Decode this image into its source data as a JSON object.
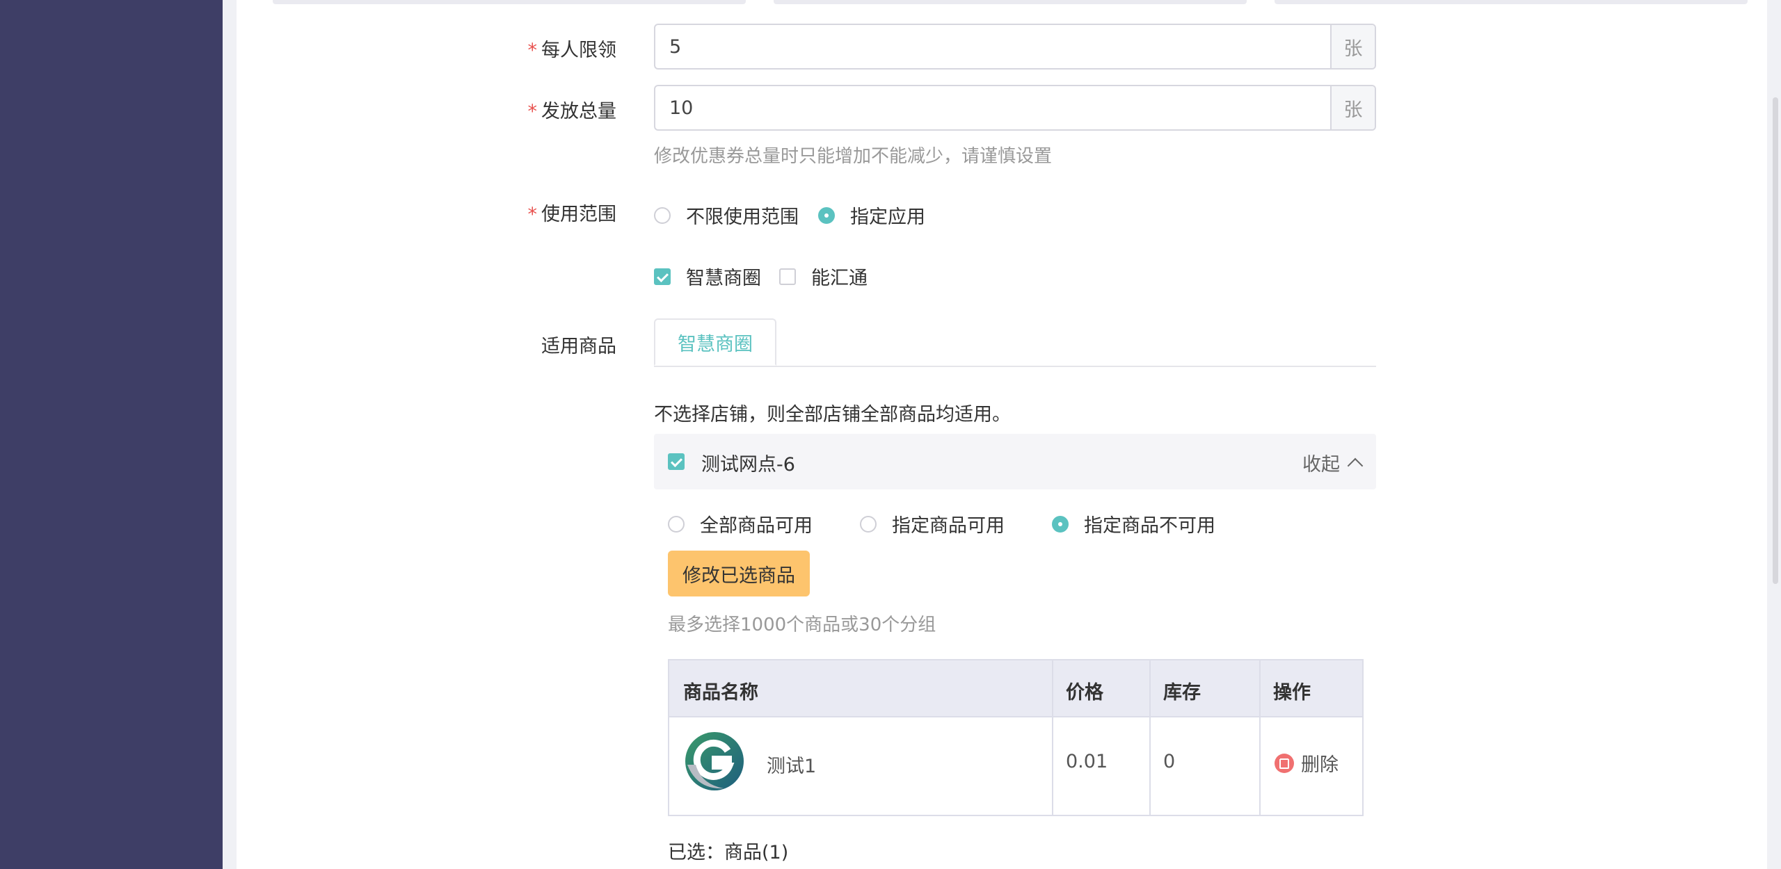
{
  "form": {
    "per_person_limit": {
      "label": "每人限领",
      "value": "5",
      "unit": "张"
    },
    "total_issue": {
      "label": "发放总量",
      "value": "10",
      "unit": "张",
      "hint": "修改优惠券总量时只能增加不能减少，请谨慎设置"
    },
    "scope": {
      "label": "使用范围",
      "options": [
        {
          "label": "不限使用范围",
          "selected": false
        },
        {
          "label": "指定应用",
          "selected": true
        }
      ],
      "apps": [
        {
          "label": "智慧商圈",
          "checked": true
        },
        {
          "label": "能汇通",
          "checked": false
        }
      ]
    },
    "goods": {
      "label": "适用商品",
      "tab": "智慧商圈",
      "note": "不选择店铺，则全部店铺全部商品均适用。",
      "shop": {
        "name": "测试网点-6",
        "checked": true,
        "collapse_label": "收起"
      },
      "goods_options": [
        {
          "label": "全部商品可用",
          "selected": false
        },
        {
          "label": "指定商品可用",
          "selected": false
        },
        {
          "label": "指定商品不可用",
          "selected": true
        }
      ],
      "modify_button": "修改已选商品",
      "limit_hint": "最多选择1000个商品或30个分组",
      "table": {
        "headers": [
          "商品名称",
          "价格",
          "库存",
          "操作"
        ],
        "rows": [
          {
            "name": "测试1",
            "price": "0.01",
            "stock": "0",
            "action": "删除"
          }
        ]
      },
      "selected_summary": "已选：商品(1)"
    }
  },
  "colors": {
    "sidebar": "#3e3e66",
    "accent": "#5bc2c0",
    "button": "#fdc46d",
    "required": "#e8514e"
  }
}
